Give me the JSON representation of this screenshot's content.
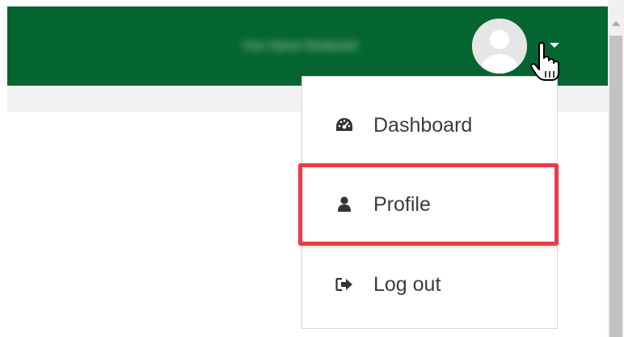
{
  "navbar": {
    "bg_color": "#046530",
    "user_name": "Your Name Redacted",
    "avatar_icon": "user-avatar-icon",
    "caret_icon": "caret-down-icon"
  },
  "user_menu": {
    "items": [
      {
        "label": "Dashboard",
        "icon": "dashboard-gauge-icon"
      },
      {
        "label": "Profile",
        "icon": "user-icon"
      },
      {
        "label": "Log out",
        "icon": "sign-out-icon"
      }
    ],
    "highlighted_item": "Profile",
    "highlight_color": "#ec3c45"
  }
}
